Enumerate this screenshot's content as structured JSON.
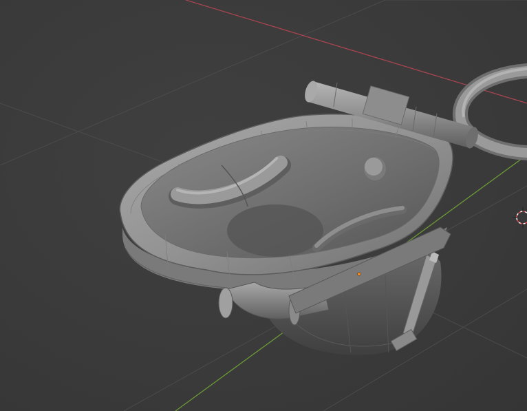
{
  "viewport": {
    "background_color": "#3d3d3d",
    "grid_color": "#4a4a4a",
    "axis_x_color": "#b34a55",
    "axis_y_color": "#6a9a3a",
    "mesh_color": "#8e8e8e",
    "wire_color": "#7a7a7a"
  },
  "scene": {
    "object": "sink-basin-mesh",
    "origin_marker_color": "#f08a24",
    "cursor_color": "#e04b4b",
    "icons": [
      "3d-cursor-icon",
      "object-origin-icon"
    ]
  }
}
